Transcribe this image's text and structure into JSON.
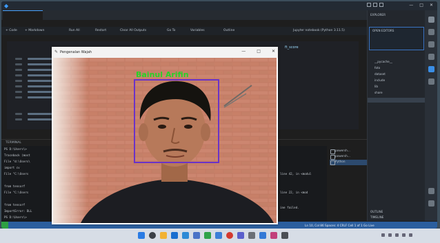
{
  "vscode": {
    "title": "",
    "tabs": [
      {
        "label": ""
      },
      {
        "label": ""
      }
    ],
    "toolbar": {
      "code": "+ Code",
      "markdown": "+ Markdown",
      "run_all": "Run All",
      "restart": "Restart",
      "clear_outputs": "Clear All Outputs",
      "goto": "Go To",
      "variables": "Variables",
      "outline": "Outline",
      "kernel": "Jupyter notebook (Python 3.11.5)"
    },
    "code_snippet": "ft_score",
    "panel_tab": "TERMINAL",
    "terminal_lines": [
      "PS D:\\Users\\>",
      "Traceback (most",
      "  File \"d:\\Users\\",
      "    import cv",
      "  File \"C:\\Users",
      "",
      "    from tensorf",
      "  File \"C:\\Users",
      "",
      "    from tensorf",
      "ImportError: DLL",
      "PS D:\\Users\\>"
    ],
    "terminal_right": [
      "line 42, in <modul",
      "",
      "line 22, in <mod",
      "",
      "ine failed.",
      ""
    ],
    "terminal_list": [
      {
        "label": "powersh..."
      },
      {
        "label": "powersh..."
      },
      {
        "label": "Python"
      }
    ],
    "explorer": {
      "header": "EXPLORER",
      "open_editors": "OPEN EDITORS",
      "open_file": "",
      "folder": "",
      "items": [
        "__pycache__",
        "foto",
        "dataset",
        "include",
        "lib",
        "share",
        "",
        "",
        "",
        "",
        ""
      ],
      "outline": "OUTLINE",
      "timeline": "TIMELINE"
    },
    "status": {
      "left": "",
      "right": "Ln 10, Col 86  Spaces: 4  CRLF  Cell 1 of 1  Go Live"
    }
  },
  "camera_window": {
    "title": "Pengenalan Wajah",
    "face_label": "Bainul Arifin",
    "controls": {
      "minimize": "—",
      "maximize": "□",
      "close": "✕"
    }
  },
  "taskbar": {
    "time": "",
    "date": ""
  },
  "colors": {
    "label_green": "#27d227",
    "box_purple": "#6a32c8",
    "statusbar_blue": "#2b5e9e"
  }
}
